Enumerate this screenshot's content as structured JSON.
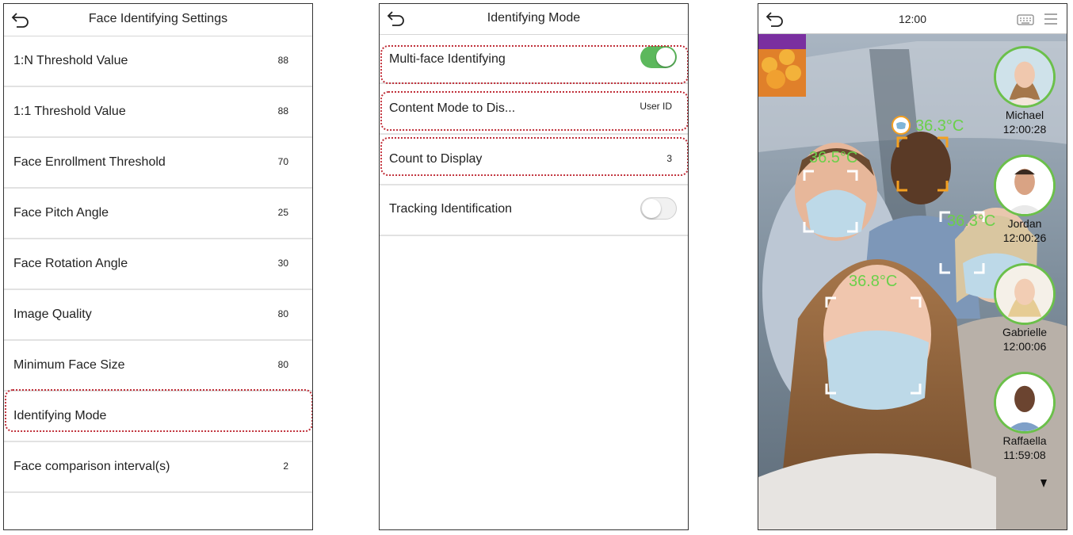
{
  "settings": {
    "title": "Face Identifying Settings",
    "items": [
      {
        "label": "1:N Threshold Value",
        "value": "88"
      },
      {
        "label": "1:1 Threshold Value",
        "value": "88"
      },
      {
        "label": "Face Enrollment Threshold",
        "value": "70"
      },
      {
        "label": "Face Pitch Angle",
        "value": "25"
      },
      {
        "label": "Face Rotation Angle",
        "value": "30"
      },
      {
        "label": "Image Quality",
        "value": "80"
      },
      {
        "label": "Minimum Face Size",
        "value": "80"
      },
      {
        "label": "Identifying Mode",
        "value": ""
      },
      {
        "label": "Face comparison interval(s)",
        "value": "2"
      }
    ]
  },
  "mode": {
    "title": "Identifying Mode",
    "items": [
      {
        "label": "Multi-face Identifying",
        "toggle": "on"
      },
      {
        "label": "Content Mode to Dis...",
        "value": "User ID"
      },
      {
        "label": "Count to Display",
        "value": "3"
      },
      {
        "label": "Tracking Identification",
        "toggle": "off"
      }
    ]
  },
  "camera": {
    "time": "12:00",
    "temperatures": [
      "36.3°C",
      "36.5°C",
      "36.3°C",
      "36.8°C"
    ],
    "recognized": [
      {
        "name": "Michael",
        "time": "12:00:28"
      },
      {
        "name": "Jordan",
        "time": "12:00:26"
      },
      {
        "name": "Gabrielle",
        "time": "12:00:06"
      },
      {
        "name": "Raffaella",
        "time": "11:59:08"
      }
    ],
    "colors": {
      "temperature": "#6bd04a",
      "highlight": "#c0303a",
      "toggle_on": "#5cb85c",
      "avatar_ring": "#6bc04a"
    }
  }
}
